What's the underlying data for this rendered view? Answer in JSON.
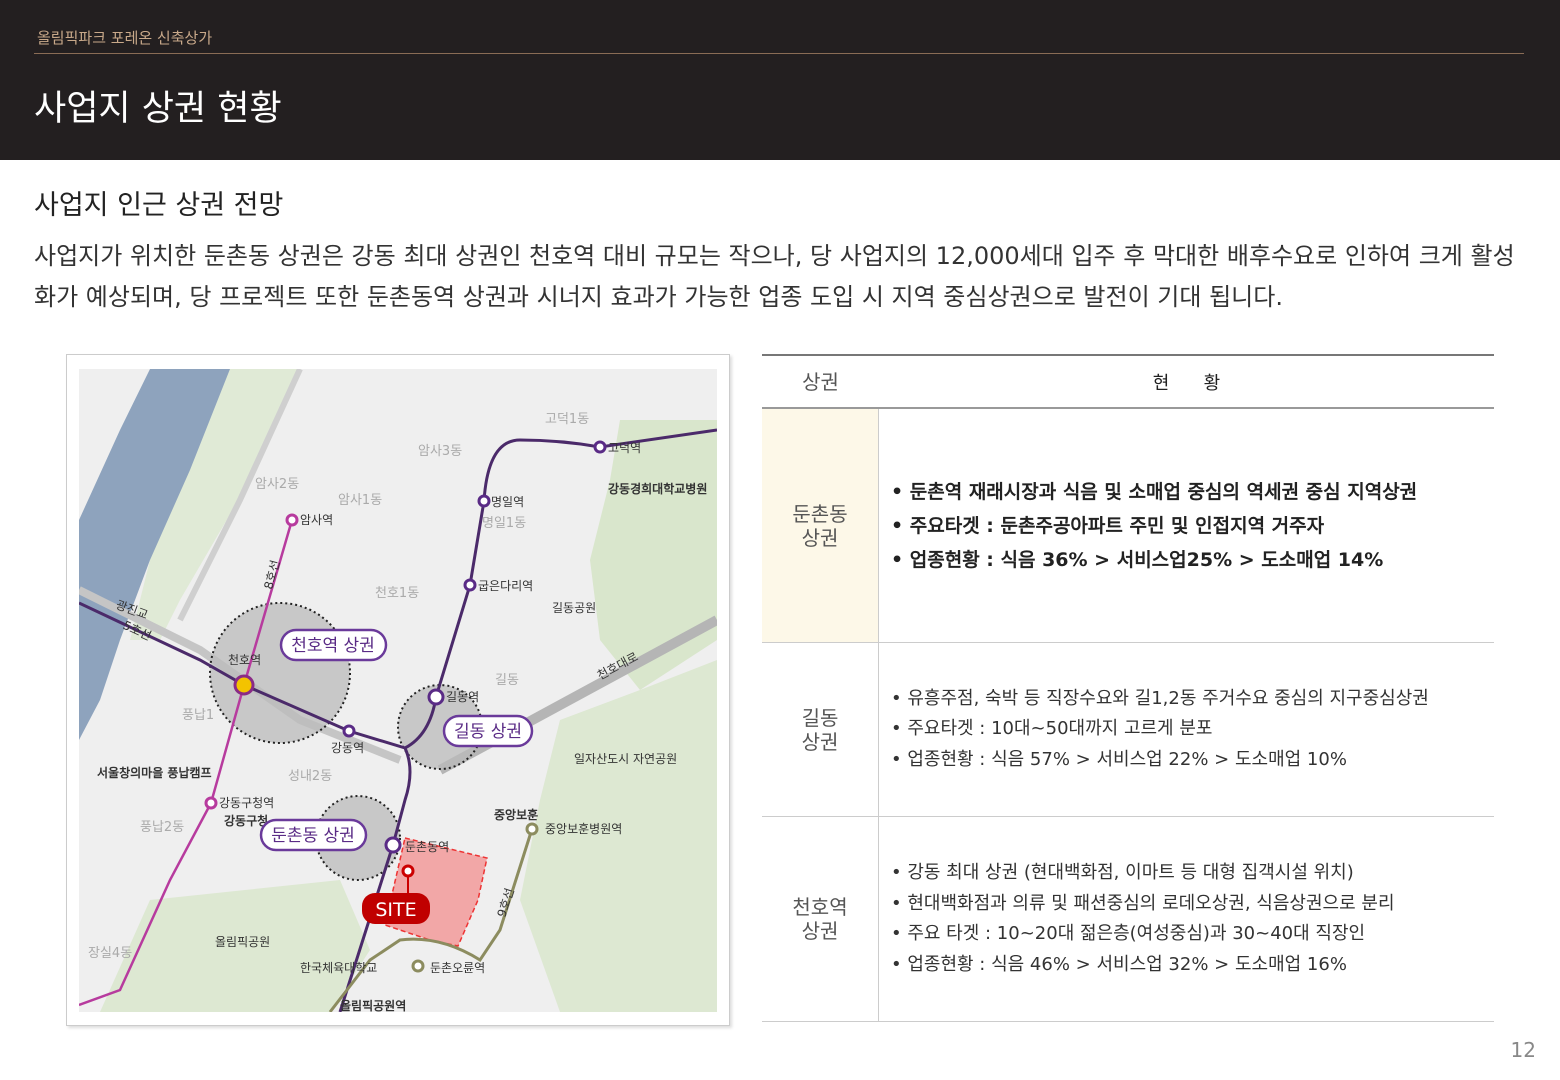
{
  "header": {
    "brand": "올림픽파크 포레온 신축상가",
    "title": "사업지 상권 현황"
  },
  "section": {
    "subtitle": "사업지 인근 상권 전망",
    "desc": "사업지가 위치한 둔촌동 상권은 강동 최대 상권인 천호역 대비 규모는 작으나, 당 사업지의 12,000세대 입주 후 막대한 배후수요로 인하여 크게 활성화가 예상되며, 당 프로젝트 또한 둔촌동역 상권과 시너지 효과가 가능한 업종 도입 시 지역 중심상권으로 발전이 기대 됩니다."
  },
  "map": {
    "areas": [
      "천호역 상권",
      "길동 상권",
      "둔촌동 상권"
    ],
    "site": "SITE",
    "stations": [
      "암사역",
      "천호역",
      "강동구청역",
      "고덕역",
      "명일역",
      "굽은다리역",
      "길동역",
      "강동역",
      "둔촌동역",
      "둔촌오륜역",
      "중앙보훈병원역",
      "올림픽공원역"
    ],
    "lines": [
      "5호선",
      "8호선",
      "9호선"
    ],
    "places": [
      "암사3동",
      "암사2동",
      "암사1동",
      "고덕1동",
      "명일1동",
      "천호1동",
      "길동",
      "성내2동",
      "풍납1",
      "풍납2동",
      "장실4동",
      "길동공원",
      "일자산도시 자연공원",
      "서울창의마을 풍납캠프",
      "올림픽공원",
      "한국체육대학교",
      "강동구청",
      "중앙보훈",
      "광진교",
      "천호대로",
      "강동경희대학교병원"
    ]
  },
  "table": {
    "headers": [
      "상권",
      "현      황"
    ],
    "rows": [
      {
        "name": "둔촌동 상권",
        "items": [
          "• 둔촌역 재래시장과 식음 및 소매업 중심의 역세권 중심 지역상권",
          "• 주요타겟 : 둔촌주공아파트 주민 및 인접지역 거주자",
          "• 업종현황 : 식음 36% > 서비스업25% > 도소매업 14%"
        ]
      },
      {
        "name": "길동 상권",
        "items": [
          "•  유흥주점, 숙박 등 직장수요와 길1,2동 주거수요 중심의 지구중심상권",
          "•  주요타겟 : 10대~50대까지 고르게 분포",
          "•  업종현황 : 식음 57% > 서비스업 22% > 도소매업 10%"
        ]
      },
      {
        "name": "천호역 상권",
        "items": [
          "• 강동 최대 상권 (현대백화점, 이마트 등 대형 집객시설 위치)",
          "• 현대백화점과 의류 및 패션중심의 로데오상권, 식음상권으로 분리",
          "• 주요 타겟  :  10~20대 젊은층(여성중심)과 30~40대 직장인",
          "• 업종현황  : 식음 46% > 서비스업 32% > 도소매업 16%"
        ]
      }
    ]
  },
  "page_number": "12"
}
